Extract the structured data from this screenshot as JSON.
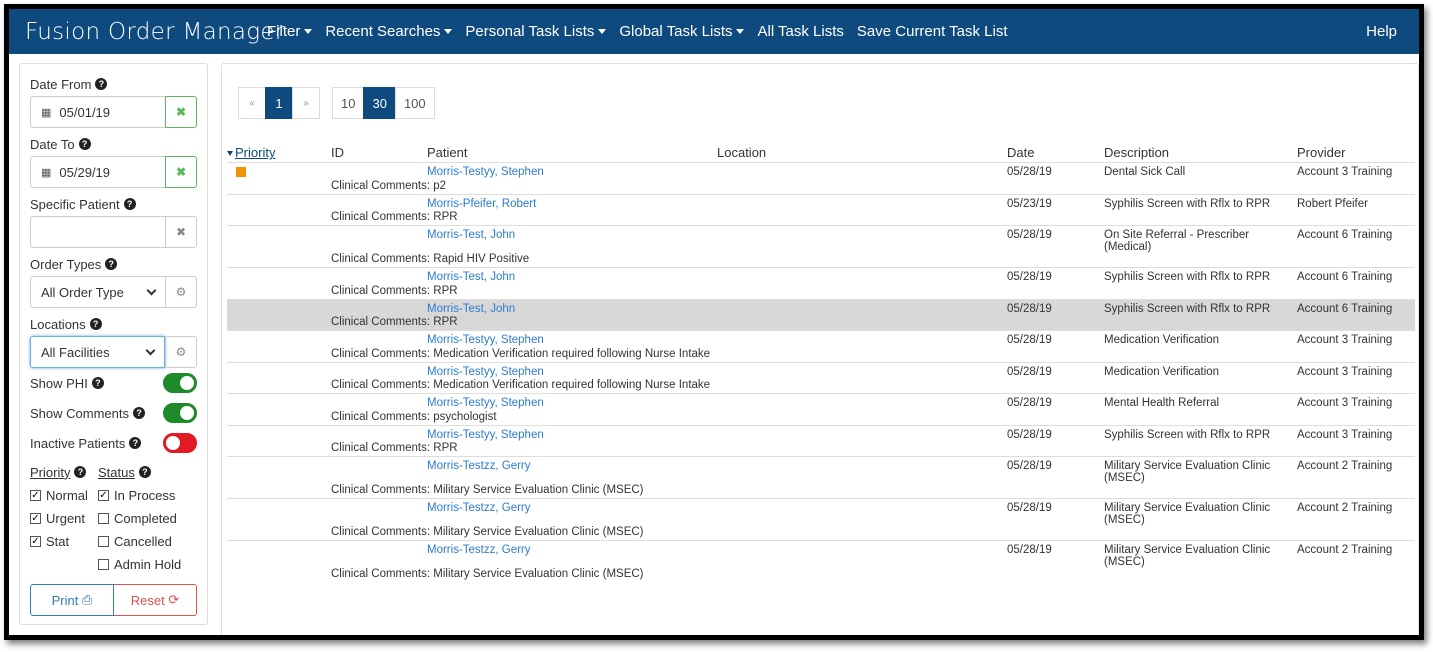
{
  "nav": {
    "brand": "Fusion Order Manager",
    "items": [
      {
        "label": "Filter",
        "dropdown": true
      },
      {
        "label": "Recent Searches",
        "dropdown": true
      },
      {
        "label": "Personal Task Lists",
        "dropdown": true
      },
      {
        "label": "Global Task Lists",
        "dropdown": true
      },
      {
        "label": "All Task Lists",
        "dropdown": false
      },
      {
        "label": "Save Current Task List",
        "dropdown": false
      }
    ],
    "help": "Help"
  },
  "sidebar": {
    "date_from_label": "Date From",
    "date_from_value": "05/01/19",
    "date_to_label": "Date To",
    "date_to_value": "05/29/19",
    "specific_patient_label": "Specific Patient",
    "specific_patient_value": "",
    "order_types_label": "Order Types",
    "order_types_value": "All Order Type",
    "locations_label": "Locations",
    "locations_value": "All Facilities",
    "show_phi_label": "Show PHI",
    "show_phi_on": true,
    "show_comments_label": "Show Comments",
    "show_comments_on": true,
    "inactive_patients_label": "Inactive Patients",
    "inactive_patients_on": false,
    "priority_label": "Priority",
    "status_label": "Status",
    "priority_options": [
      {
        "label": "Normal",
        "checked": true
      },
      {
        "label": "Urgent",
        "checked": true
      },
      {
        "label": "Stat",
        "checked": true
      }
    ],
    "status_options": [
      {
        "label": "In Process",
        "checked": true
      },
      {
        "label": "Completed",
        "checked": false
      },
      {
        "label": "Cancelled",
        "checked": false
      },
      {
        "label": "Admin Hold",
        "checked": false
      }
    ],
    "print_label": "Print",
    "reset_label": "Reset"
  },
  "pager": {
    "prev": "«",
    "current": "1",
    "next": "»",
    "sizes": [
      "10",
      "30",
      "100"
    ],
    "active_size": "30"
  },
  "table": {
    "headers": {
      "priority": "Priority",
      "id": "ID",
      "patient": "Patient",
      "location": "Location",
      "date": "Date",
      "description": "Description",
      "provider": "Provider"
    },
    "comment_prefix": "Clinical Comments:",
    "rows": [
      {
        "flag": true,
        "patient": "Morris-Testyy, Stephen",
        "date": "05/28/19",
        "description": "Dental Sick Call",
        "provider": "Account 3 Training",
        "comment": "p2"
      },
      {
        "flag": false,
        "patient": "Morris-Pfeifer, Robert",
        "date": "05/23/19",
        "description": "Syphilis Screen with Rflx to RPR",
        "provider": "Robert Pfeifer",
        "comment": "RPR"
      },
      {
        "flag": false,
        "patient": "Morris-Test, John",
        "date": "05/28/19",
        "description": "On Site Referral - Prescriber (Medical)",
        "provider": "Account 6 Training",
        "comment": "Rapid HIV Positive"
      },
      {
        "flag": false,
        "patient": "Morris-Test, John",
        "date": "05/28/19",
        "description": "Syphilis Screen with Rflx to RPR",
        "provider": "Account 6 Training",
        "comment": "RPR"
      },
      {
        "flag": false,
        "patient": "Morris-Test, John",
        "date": "05/28/19",
        "description": "Syphilis Screen with Rflx to RPR",
        "provider": "Account 6 Training",
        "comment": "RPR",
        "highlight": true
      },
      {
        "flag": false,
        "patient": "Morris-Testyy, Stephen",
        "date": "05/28/19",
        "description": "Medication Verification",
        "provider": "Account 3 Training",
        "comment": "Medication Verification required following Nurse Intake"
      },
      {
        "flag": false,
        "patient": "Morris-Testyy, Stephen",
        "date": "05/28/19",
        "description": "Medication Verification",
        "provider": "Account 3 Training",
        "comment": "Medication Verification required following Nurse Intake"
      },
      {
        "flag": false,
        "patient": "Morris-Testyy, Stephen",
        "date": "05/28/19",
        "description": "Mental Health Referral",
        "provider": "Account 3 Training",
        "comment": "psychologist"
      },
      {
        "flag": false,
        "patient": "Morris-Testyy, Stephen",
        "date": "05/28/19",
        "description": "Syphilis Screen with Rflx to RPR",
        "provider": "Account 3 Training",
        "comment": "RPR"
      },
      {
        "flag": false,
        "patient": "Morris-Testzz, Gerry",
        "date": "05/28/19",
        "description": "Military Service Evaluation Clinic (MSEC)",
        "provider": "Account 2 Training",
        "comment": "Military Service Evaluation Clinic (MSEC)"
      },
      {
        "flag": false,
        "patient": "Morris-Testzz, Gerry",
        "date": "05/28/19",
        "description": "Military Service Evaluation Clinic (MSEC)",
        "provider": "Account 2 Training",
        "comment": "Military Service Evaluation Clinic (MSEC)"
      },
      {
        "flag": false,
        "patient": "Morris-Testzz, Gerry",
        "date": "05/28/19",
        "description": "Military Service Evaluation Clinic (MSEC)",
        "provider": "Account 2 Training",
        "comment": "Military Service Evaluation Clinic (MSEC)"
      }
    ]
  }
}
